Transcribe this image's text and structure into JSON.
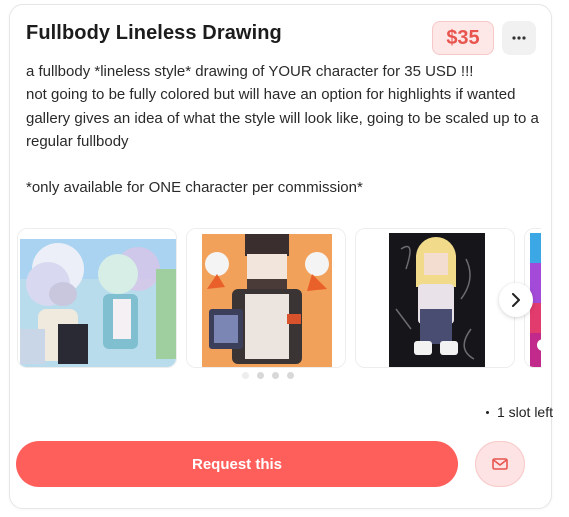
{
  "listing": {
    "title": "Fullbody Lineless Drawing",
    "price": "$35",
    "description": "a fullbody *lineless style* drawing of YOUR character for 35 USD !!!\nnot going to be fully colored but will have an option for highlights if wanted\ngallery gives an idea of what the style will look like, going to be scaled up to a regular fullbody\n\n*only available for ONE character per commission*",
    "slots_text": "1 slot left",
    "request_label": "Request this"
  },
  "icons": {
    "more": "more-horizontal-icon",
    "next": "chevron-right-icon",
    "message": "mail-icon"
  },
  "gallery": {
    "page_count": 4,
    "active_index": 0
  },
  "colors": {
    "accent": "#ff5f5b",
    "price_text": "#e8544e",
    "price_bg": "#fde7e7"
  }
}
